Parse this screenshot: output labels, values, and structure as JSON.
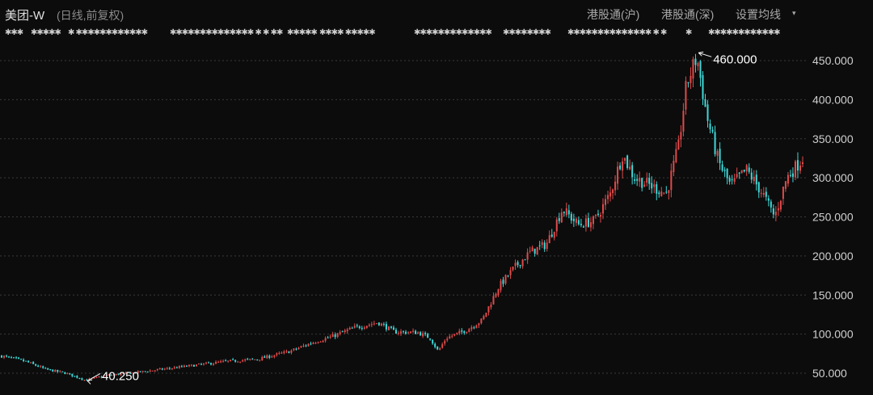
{
  "header": {
    "stock_name": "美团-W",
    "mode": "(日线,前复权)",
    "btn_hk_sh": "港股通(沪)",
    "btn_hk_sz": "港股通(深)",
    "btn_ma": "设置均线",
    "caret": "▾"
  },
  "event_markers": [
    "✱✱✱",
    "✱✱✱✱✱",
    "✱ ✱✱✱✱✱✱✱✱✱✱✱✱",
    "✱✱✱✱✱✱✱✱✱✱✱✱✱✱ ✱ ✱ ✱✱",
    "✱✱✱✱✱",
    "✱✱✱✱ ✱✱✱✱✱",
    "✱✱✱✱✱✱✱✱✱✱✱✱✱",
    "✱✱✱✱✱✱✱✱",
    "✱✱✱✱✱✱✱✱✱✱✱✱✱✱ ✱ ✱",
    "✱",
    "✱✱✱✱✱✱✱✱✱✱✱✱"
  ],
  "colors": {
    "up": "#e04a4a",
    "down": "#3fd8d8",
    "background": "#0c0c0c",
    "grid": "#3a3a3a"
  },
  "chart_data": {
    "type": "candlestick",
    "ylim": [
      35,
      480
    ],
    "yticks": [
      "50.000",
      "100.000",
      "150.000",
      "200.000",
      "250.000",
      "300.000",
      "350.000",
      "400.000",
      "450.000"
    ],
    "ytick_values": [
      50,
      100,
      150,
      200,
      250,
      300,
      350,
      400,
      450
    ],
    "grid": true,
    "annotations": [
      {
        "label": "460.000",
        "value": 460.0,
        "index_fraction": 0.868
      },
      {
        "label": "40.250",
        "value": 40.25,
        "index_fraction": 0.105
      }
    ],
    "close_path": [
      [
        0.0,
        72
      ],
      [
        0.03,
        65
      ],
      [
        0.055,
        55
      ],
      [
        0.08,
        50
      ],
      [
        0.105,
        41
      ],
      [
        0.13,
        47
      ],
      [
        0.16,
        50
      ],
      [
        0.2,
        55
      ],
      [
        0.24,
        60
      ],
      [
        0.28,
        65
      ],
      [
        0.32,
        68
      ],
      [
        0.36,
        78
      ],
      [
        0.39,
        90
      ],
      [
        0.41,
        96
      ],
      [
        0.44,
        108
      ],
      [
        0.47,
        115
      ],
      [
        0.49,
        103
      ],
      [
        0.52,
        102
      ],
      [
        0.535,
        95
      ],
      [
        0.545,
        78
      ],
      [
        0.555,
        95
      ],
      [
        0.58,
        105
      ],
      [
        0.6,
        118
      ],
      [
        0.62,
        160
      ],
      [
        0.64,
        185
      ],
      [
        0.66,
        205
      ],
      [
        0.68,
        215
      ],
      [
        0.7,
        260
      ],
      [
        0.72,
        240
      ],
      [
        0.74,
        245
      ],
      [
        0.76,
        280
      ],
      [
        0.775,
        330
      ],
      [
        0.79,
        300
      ],
      [
        0.81,
        290
      ],
      [
        0.83,
        280
      ],
      [
        0.845,
        340
      ],
      [
        0.855,
        420
      ],
      [
        0.868,
        455
      ],
      [
        0.88,
        380
      ],
      [
        0.895,
        320
      ],
      [
        0.91,
        290
      ],
      [
        0.93,
        310
      ],
      [
        0.95,
        280
      ],
      [
        0.965,
        250
      ],
      [
        0.98,
        300
      ],
      [
        1.0,
        325
      ]
    ]
  }
}
